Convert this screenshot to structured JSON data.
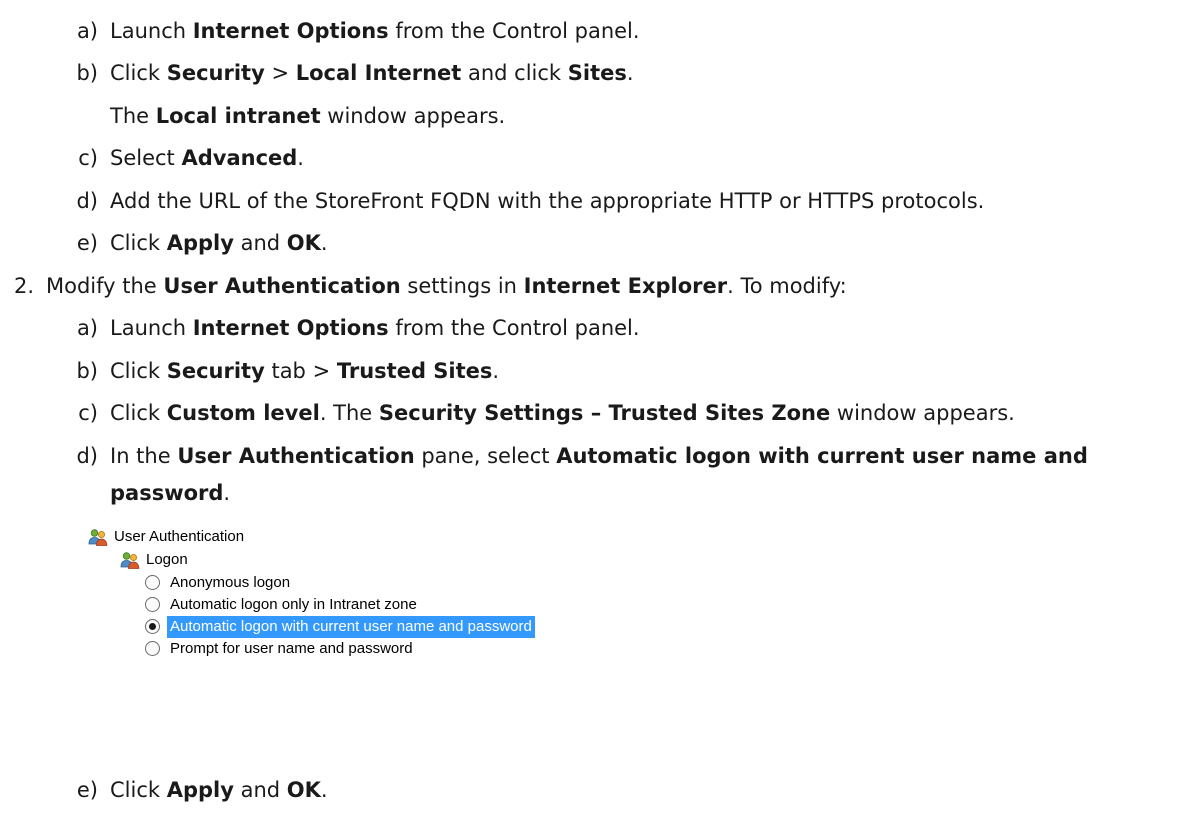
{
  "steps": [
    {
      "marker": "a)",
      "parts": [
        "Launch ",
        "Internet Options",
        " from the Control panel."
      ]
    },
    {
      "marker": "b)",
      "parts": [
        "Click ",
        "Security",
        " > ",
        "Local Internet",
        " and click ",
        "Sites",
        "."
      ]
    },
    {
      "marker": "",
      "parts": [
        "The ",
        "Local intranet",
        " window appears."
      ]
    },
    {
      "marker": "c)",
      "parts": [
        "Select ",
        "Advanced",
        "."
      ]
    },
    {
      "marker": "d)",
      "parts": [
        "Add the URL of the StoreFront FQDN with the appropriate HTTP or HTTPS protocols."
      ]
    },
    {
      "marker": "e)",
      "parts": [
        "Click ",
        "Apply",
        " and ",
        "OK",
        "."
      ]
    },
    {
      "marker": "2.",
      "parts": [
        "Modify the ",
        "User Authentication",
        " settings in ",
        "Internet Explorer",
        ".  To modify:"
      ]
    },
    {
      "marker": "a)",
      "parts": [
        "Launch ",
        "Internet Options",
        " from the Control panel."
      ]
    },
    {
      "marker": "b)",
      "parts": [
        "Click ",
        "Security",
        " tab > ",
        "Trusted Sites",
        "."
      ]
    },
    {
      "marker": "c)",
      "parts": [
        "Click ",
        "Custom level",
        ". The ",
        "Security Settings – Trusted Sites Zone",
        " window appears."
      ]
    },
    {
      "marker": "d)",
      "parts": [
        "In the ",
        "User Authentication",
        " pane, select ",
        "Automatic logon with current user name and"
      ]
    },
    {
      "marker": "",
      "parts": [
        "",
        "password",
        "."
      ]
    },
    {
      "marker": "e)",
      "parts": [
        "Click ",
        "Apply",
        " and ",
        "OK",
        "."
      ]
    }
  ],
  "screenshot": {
    "group_label": "User Authentication",
    "subgroup_label": "Logon",
    "options": [
      {
        "label": "Anonymous logon",
        "checked": false
      },
      {
        "label": "Automatic logon only in Intranet zone",
        "checked": false
      },
      {
        "label": "Automatic logon with current user name and password",
        "checked": true
      },
      {
        "label": "Prompt for user name and password",
        "checked": false
      }
    ]
  }
}
